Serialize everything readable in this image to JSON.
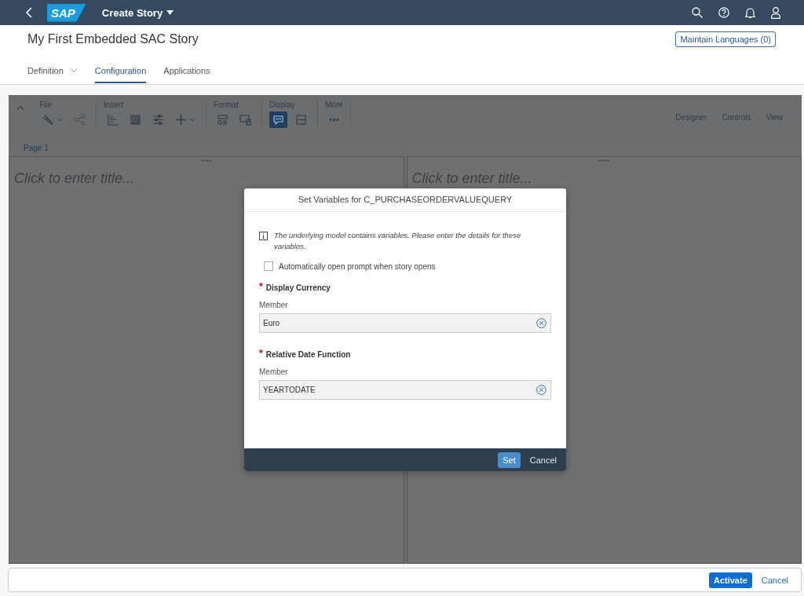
{
  "shell": {
    "logo": "SAP",
    "title": "Create Story"
  },
  "page": {
    "title": "My First Embedded SAC Story",
    "languages_button": "Maintain Languages (0)"
  },
  "tabs": [
    {
      "label": "Definition",
      "selected": false,
      "menu": true
    },
    {
      "label": "Configuration",
      "selected": true,
      "menu": false
    },
    {
      "label": "Applications",
      "selected": false,
      "menu": false
    }
  ],
  "toolbar": {
    "groups": [
      {
        "label": "File",
        "tools": [
          {
            "menu": true,
            "selected": false,
            "disabled": false
          },
          {
            "menu": false,
            "selected": false,
            "disabled": true
          }
        ]
      },
      {
        "label": "Insert",
        "tools": [
          {
            "menu": false,
            "selected": false,
            "disabled": false
          },
          {
            "menu": false,
            "selected": false,
            "disabled": false
          },
          {
            "menu": false,
            "selected": false,
            "disabled": false
          },
          {
            "menu": true,
            "selected": false,
            "disabled": false
          }
        ]
      },
      {
        "label": "Format",
        "tools": [
          {
            "menu": false,
            "selected": false,
            "disabled": false
          },
          {
            "menu": false,
            "selected": false,
            "disabled": false
          }
        ]
      },
      {
        "label": "Display",
        "tools": [
          {
            "menu": false,
            "selected": true,
            "disabled": false
          },
          {
            "menu": false,
            "selected": false,
            "disabled": false
          }
        ]
      },
      {
        "label": "More",
        "tools": [
          {
            "menu": false,
            "selected": false,
            "disabled": false
          }
        ]
      }
    ],
    "modes": [
      "Designer",
      "Controls",
      "View"
    ]
  },
  "page_tabs": [
    {
      "label": "Page 1",
      "selected": true
    }
  ],
  "panels": [
    {
      "title_hint": "Click to enter title..."
    },
    {
      "title_hint": "Click to enter title..."
    }
  ],
  "dialog": {
    "title": "Set Variables for C_PURCHASEORDERVALUEQUERY",
    "info": "The underlying model contains variables. Please enter the details for these variables.",
    "checkbox": {
      "label": "Automatically open prompt when story opens",
      "checked": false
    },
    "variables": [
      {
        "label": "Display Currency",
        "required_mark": "*",
        "field_label": "Member",
        "value": "Euro"
      },
      {
        "label": "Relative Date Function",
        "required_mark": "*",
        "field_label": "Member",
        "value": "YEARTODATE"
      }
    ],
    "buttons": [
      {
        "label": "Set",
        "kind": "primary"
      },
      {
        "label": "Cancel",
        "kind": "plain"
      }
    ]
  },
  "footer": {
    "buttons": [
      {
        "label": "Activate",
        "kind": "primary"
      },
      {
        "label": "Cancel",
        "kind": "plain"
      }
    ]
  }
}
